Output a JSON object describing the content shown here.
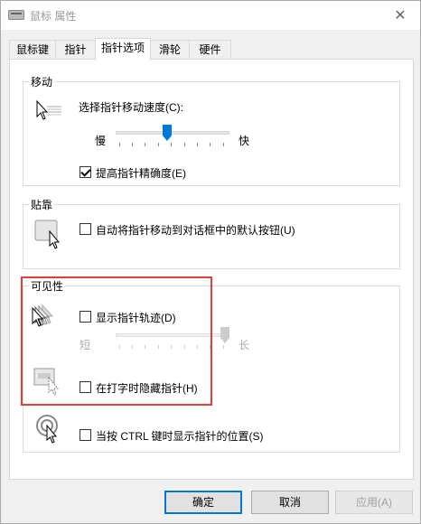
{
  "window": {
    "title": "鼠标 属性",
    "close_glyph": "✕"
  },
  "tabs": [
    {
      "label": "鼠标键"
    },
    {
      "label": "指针"
    },
    {
      "label": "指针选项",
      "active": true
    },
    {
      "label": "滑轮"
    },
    {
      "label": "硬件"
    }
  ],
  "motion": {
    "title": "移动",
    "speed_label": "选择指针移动速度(C):",
    "slow_label": "慢",
    "fast_label": "快",
    "speed_value": 0.45,
    "precision_label": "提高指针精确度(E)",
    "precision_checked": true
  },
  "snap": {
    "title": "贴靠",
    "label": "自动将指针移动到对话框中的默认按钮(U)",
    "checked": false
  },
  "visibility": {
    "title": "可见性",
    "trails_label": "显示指针轨迹(D)",
    "trails_checked": false,
    "short_label": "短",
    "long_label": "长",
    "trail_length_value": 1.0,
    "hide_typing_label": "在打字时隐藏指针(H)",
    "hide_typing_checked": false,
    "ctrl_label": "当按 CTRL 键时显示指针的位置(S)",
    "ctrl_checked": false
  },
  "buttons": {
    "ok": "确定",
    "cancel": "取消",
    "apply": "应用(A)"
  },
  "colors": {
    "accent": "#0078d7",
    "highlight_outline": "#e0403a"
  }
}
